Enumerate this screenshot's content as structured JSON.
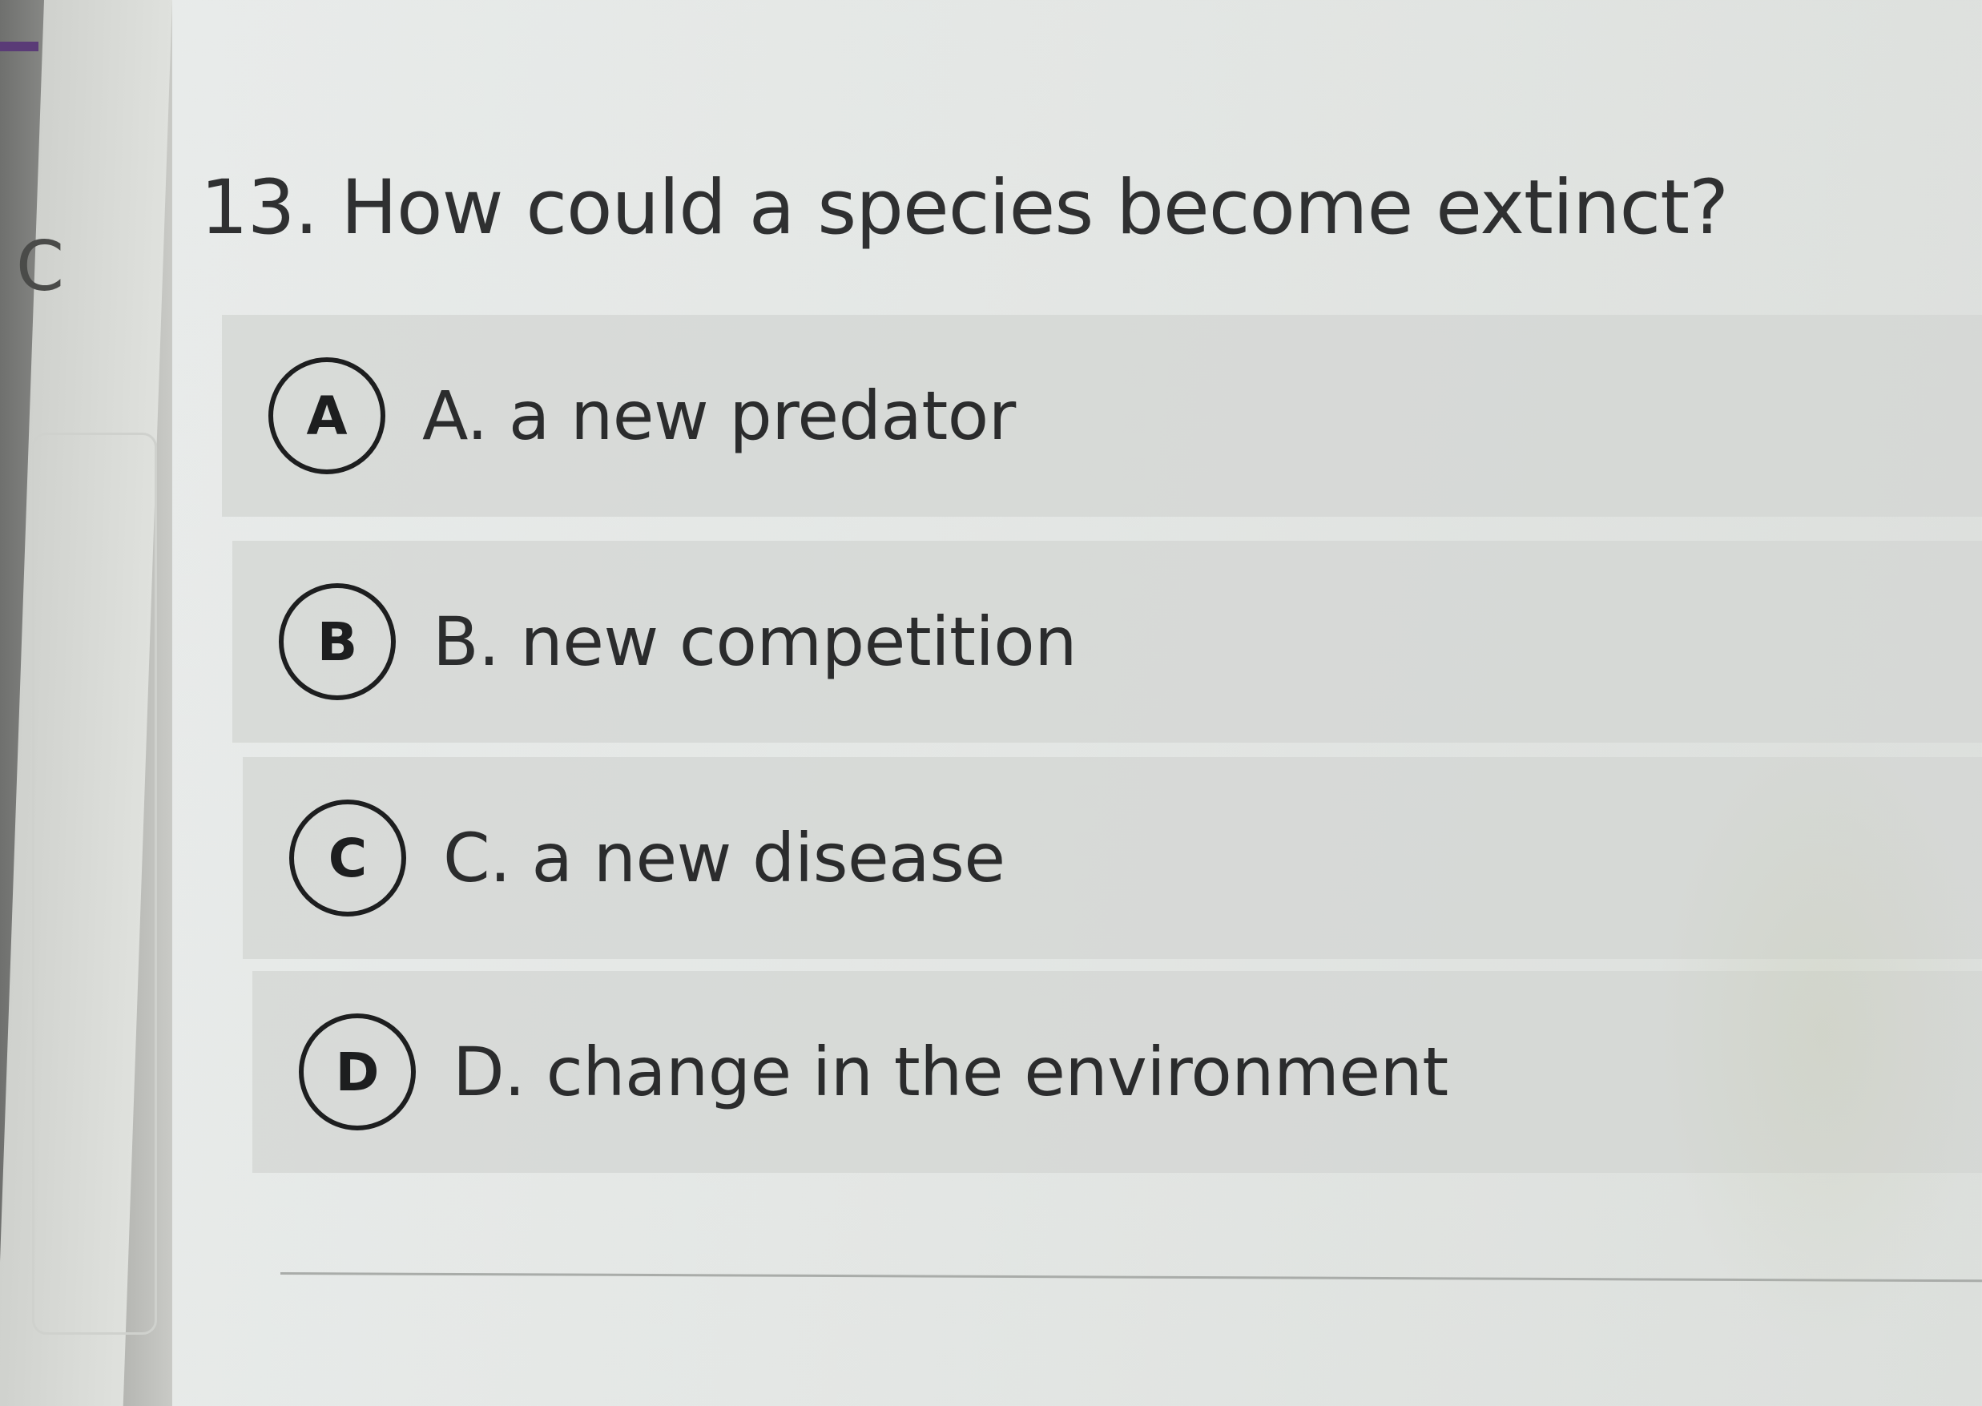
{
  "sidebar": {
    "edge_letter": "C"
  },
  "question": {
    "title": "13. How could a species become extinct?",
    "options": [
      {
        "letter": "A",
        "text": "A. a new predator"
      },
      {
        "letter": "B",
        "text": "B. new competition"
      },
      {
        "letter": "C",
        "text": "C. a new disease"
      },
      {
        "letter": "D",
        "text": "D. change in the environment"
      }
    ]
  },
  "colors": {
    "accent": "#5a3b77",
    "text": "#2f3031",
    "option_background": "#d3d6d3",
    "circle_border": "#1d1e1f"
  }
}
